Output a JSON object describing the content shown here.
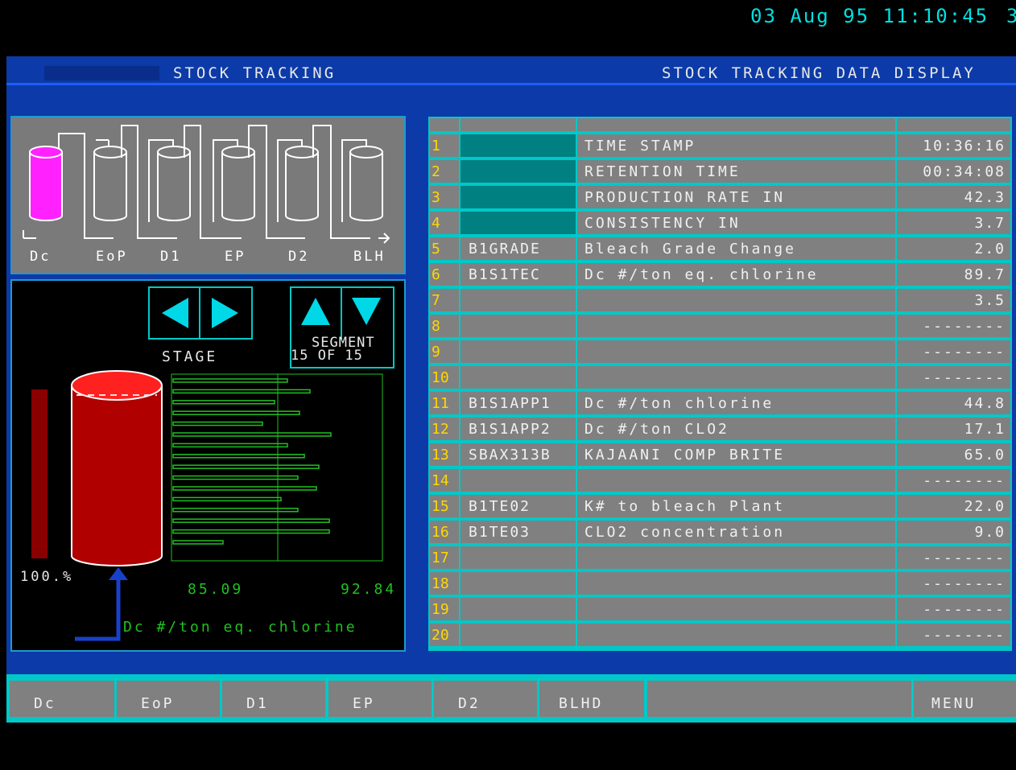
{
  "header": {
    "datetime": "03 Aug 95 11:10:45",
    "datetime_overflow": "3",
    "app_title": "STOCK TRACKING",
    "display_title": "STOCK TRACKING DATA DISPLAY"
  },
  "overview": {
    "stages": [
      "Dc",
      "EoP",
      "D1",
      "EP",
      "D2",
      "BLH"
    ],
    "active_stage": "Dc",
    "active_color": "#ff22ff"
  },
  "detail": {
    "stage_label": "STAGE",
    "segment_label": "SEGMENT",
    "segment_count": "15 OF 15",
    "level_label": "100.%",
    "level_fraction": 1.0,
    "bar_min": "85.09",
    "bar_max": "92.84",
    "parameter": "Dc #/ton eq. chlorine",
    "segment_bars": [
      0.55,
      0.66,
      0.49,
      0.61,
      0.43,
      0.76,
      0.55,
      0.63,
      0.7,
      0.6,
      0.69,
      0.52,
      0.6,
      0.75,
      0.75,
      0.24
    ],
    "colors": {
      "tank": "#b00000",
      "tank_top": "#ff2020",
      "bars": "#20c020",
      "arrow": "#1840c8"
    }
  },
  "table": {
    "rows": [
      {
        "num": "1",
        "tag": "",
        "desc": "TIME STAMP",
        "value": "10:36:16",
        "teal": true
      },
      {
        "num": "2",
        "tag": "",
        "desc": "RETENTION TIME",
        "value": "00:34:08",
        "teal": true
      },
      {
        "num": "3",
        "tag": "",
        "desc": "PRODUCTION RATE IN",
        "value": "42.3",
        "teal": true
      },
      {
        "num": "4",
        "tag": "",
        "desc": "CONSISTENCY IN",
        "value": "3.7",
        "teal": true
      },
      {
        "num": "5",
        "tag": "B1GRADE",
        "desc": "Bleach Grade Change",
        "value": "2.0",
        "teal": false
      },
      {
        "num": "6",
        "tag": "B1S1TEC",
        "desc": "Dc #/ton eq. chlorine",
        "value": "89.7",
        "teal": false
      },
      {
        "num": "7",
        "tag": "",
        "desc": "",
        "value": "3.5",
        "teal": false
      },
      {
        "num": "8",
        "tag": "",
        "desc": "",
        "value": "--------",
        "teal": false
      },
      {
        "num": "9",
        "tag": "",
        "desc": "",
        "value": "--------",
        "teal": false
      },
      {
        "num": "10",
        "tag": "",
        "desc": "",
        "value": "--------",
        "teal": false
      },
      {
        "num": "11",
        "tag": "B1S1APP1",
        "desc": "Dc #/ton chlorine",
        "value": "44.8",
        "teal": false
      },
      {
        "num": "12",
        "tag": "B1S1APP2",
        "desc": "Dc #/ton CLO2",
        "value": "17.1",
        "teal": false
      },
      {
        "num": "13",
        "tag": "SBAX313B",
        "desc": "KAJAANI COMP BRITE",
        "value": "65.0",
        "teal": false
      },
      {
        "num": "14",
        "tag": "",
        "desc": "",
        "value": "--------",
        "teal": false
      },
      {
        "num": "15",
        "tag": "B1TE02",
        "desc": "K# to bleach Plant",
        "value": "22.0",
        "teal": false
      },
      {
        "num": "16",
        "tag": "B1TE03",
        "desc": "CLO2 concentration",
        "value": "9.0",
        "teal": false
      },
      {
        "num": "17",
        "tag": "",
        "desc": "",
        "value": "--------",
        "teal": false
      },
      {
        "num": "18",
        "tag": "",
        "desc": "",
        "value": "--------",
        "teal": false
      },
      {
        "num": "19",
        "tag": "",
        "desc": "",
        "value": "--------",
        "teal": false
      },
      {
        "num": "20",
        "tag": "",
        "desc": "",
        "value": "--------",
        "teal": false
      }
    ]
  },
  "function_keys": [
    "Dc",
    "EoP",
    "D1",
    "EP",
    "D2",
    "BLHD",
    "",
    "MENU"
  ]
}
